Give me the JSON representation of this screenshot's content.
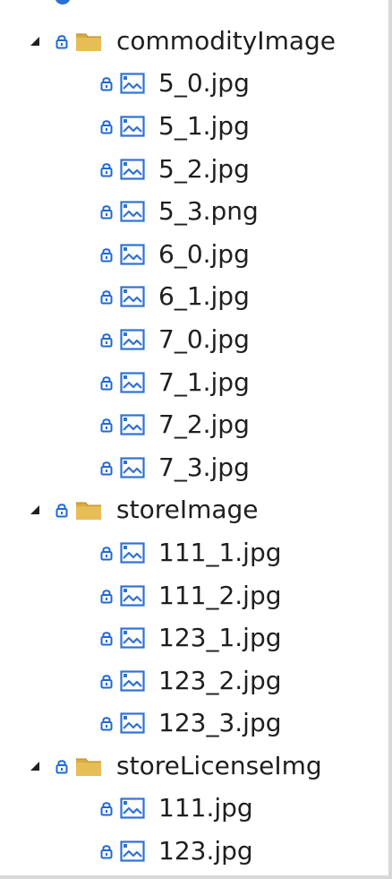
{
  "tree": {
    "folders": [
      {
        "name": "commodityImage",
        "files": [
          "5_0.jpg",
          "5_1.jpg",
          "5_2.jpg",
          "5_3.png",
          "6_0.jpg",
          "6_1.jpg",
          "7_0.jpg",
          "7_1.jpg",
          "7_2.jpg",
          "7_3.jpg"
        ]
      },
      {
        "name": "storeImage",
        "files": [
          "111_1.jpg",
          "111_2.jpg",
          "123_1.jpg",
          "123_2.jpg",
          "123_3.jpg"
        ]
      },
      {
        "name": "storeLicenseImg",
        "files": [
          "111.jpg",
          "123.jpg"
        ]
      }
    ],
    "icons": {
      "expanded": "expanded-caret-icon",
      "lock": "lock-icon",
      "folder": "folder-icon",
      "image_file": "image-file-icon"
    },
    "colors": {
      "lock_blue": "#1f68d8",
      "folder_yellow": "#d9aa3e",
      "folder_dark": "#b88a24",
      "image_blue": "#2f72d4",
      "text": "#1f1f1f"
    }
  }
}
